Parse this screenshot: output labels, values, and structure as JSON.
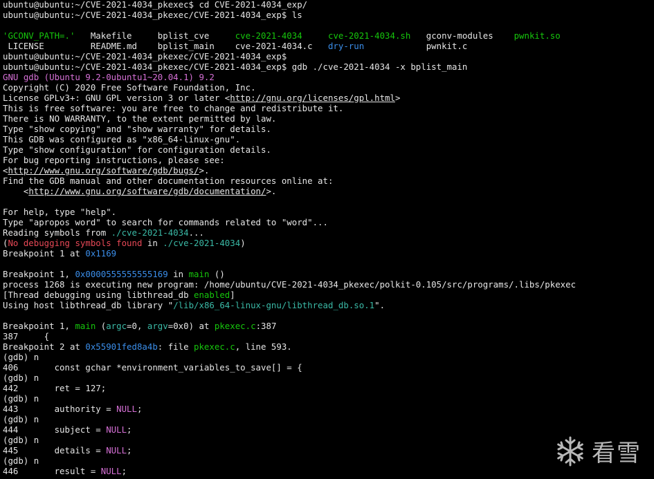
{
  "colors": {
    "background": "#000000",
    "text": "#e6e6e6",
    "lime": "#16c60c",
    "teal": "#3ab9a6",
    "blue": "#3b8eea",
    "red": "#e74856",
    "magenta": "#d670d6"
  },
  "terminal": {
    "lines": [
      [
        {
          "t": "ubuntu@ubuntu:~/CVE-2021-4034_pkexec$ cd CVE-2021-4034_exp/",
          "c": "default"
        }
      ],
      [
        {
          "t": "ubuntu@ubuntu:~/CVE-2021-4034_pkexec/CVE-2021-4034_exp$ ls",
          "c": "default"
        }
      ],
      [
        {
          "t": "",
          "c": "default"
        }
      ],
      [
        {
          "t": "'GCONV_PATH=.'",
          "c": "lime"
        },
        {
          "t": "   Makefile     bplist_cve     ",
          "c": "default"
        },
        {
          "t": "cve-2021-4034",
          "c": "lime"
        },
        {
          "t": "     ",
          "c": "default"
        },
        {
          "t": "cve-2021-4034.sh",
          "c": "lime"
        },
        {
          "t": "   gconv-modules    ",
          "c": "default"
        },
        {
          "t": "pwnkit.so",
          "c": "lime"
        }
      ],
      [
        {
          "t": " LICENSE         README.md    bplist_main    cve-2021-4034.c   ",
          "c": "default"
        },
        {
          "t": "dry-run",
          "c": "blue"
        },
        {
          "t": "            pwnkit.c",
          "c": "default"
        }
      ],
      [
        {
          "t": "ubuntu@ubuntu:~/CVE-2021-4034_pkexec/CVE-2021-4034_exp$",
          "c": "default"
        }
      ],
      [
        {
          "t": "ubuntu@ubuntu:~/CVE-2021-4034_pkexec/CVE-2021-4034_exp$ gdb ./cve-2021-4034 -x bplist_main",
          "c": "default"
        }
      ],
      [
        {
          "t": "GNU gdb (Ubuntu 9.2-0ubuntu1~20.04.1) 9.2",
          "c": "magenta"
        }
      ],
      [
        {
          "t": "Copyright (C) 2020 Free Software Foundation, Inc.",
          "c": "default"
        }
      ],
      [
        {
          "t": "License GPLv3+: GNU GPL version 3 or later <",
          "c": "default"
        },
        {
          "t": "http://gnu.org/licenses/gpl.html",
          "c": "link"
        },
        {
          "t": ">",
          "c": "default"
        }
      ],
      [
        {
          "t": "This is free software: you are free to change and redistribute it.",
          "c": "default"
        }
      ],
      [
        {
          "t": "There is NO WARRANTY, to the extent permitted by law.",
          "c": "default"
        }
      ],
      [
        {
          "t": "Type \"show copying\" and \"show warranty\" for details.",
          "c": "default"
        }
      ],
      [
        {
          "t": "This GDB was configured as \"x86_64-linux-gnu\".",
          "c": "default"
        }
      ],
      [
        {
          "t": "Type \"show configuration\" for configuration details.",
          "c": "default"
        }
      ],
      [
        {
          "t": "For bug reporting instructions, please see:",
          "c": "default"
        }
      ],
      [
        {
          "t": "<",
          "c": "default"
        },
        {
          "t": "http://www.gnu.org/software/gdb/bugs/",
          "c": "link"
        },
        {
          "t": ">.",
          "c": "default"
        }
      ],
      [
        {
          "t": "Find the GDB manual and other documentation resources online at:",
          "c": "default"
        }
      ],
      [
        {
          "t": "    <",
          "c": "default"
        },
        {
          "t": "http://www.gnu.org/software/gdb/documentation/",
          "c": "link"
        },
        {
          "t": ">.",
          "c": "default"
        }
      ],
      [
        {
          "t": "",
          "c": "default"
        }
      ],
      [
        {
          "t": "For help, type \"help\".",
          "c": "default"
        }
      ],
      [
        {
          "t": "Type \"apropos word\" to search for commands related to \"word\"...",
          "c": "default"
        }
      ],
      [
        {
          "t": "Reading symbols from ",
          "c": "default"
        },
        {
          "t": "./cve-2021-4034",
          "c": "teal"
        },
        {
          "t": "...",
          "c": "default"
        }
      ],
      [
        {
          "t": "(",
          "c": "default"
        },
        {
          "t": "No debugging symbols found",
          "c": "red"
        },
        {
          "t": " in ",
          "c": "default"
        },
        {
          "t": "./cve-2021-4034",
          "c": "teal"
        },
        {
          "t": ")",
          "c": "default"
        }
      ],
      [
        {
          "t": "Breakpoint 1 at ",
          "c": "default"
        },
        {
          "t": "0x1169",
          "c": "blue"
        }
      ],
      [
        {
          "t": "",
          "c": "default"
        }
      ],
      [
        {
          "t": "Breakpoint 1, ",
          "c": "default"
        },
        {
          "t": "0x0000555555555169",
          "c": "blue"
        },
        {
          "t": " in ",
          "c": "default"
        },
        {
          "t": "main",
          "c": "lime"
        },
        {
          "t": " ()",
          "c": "default"
        }
      ],
      [
        {
          "t": "process 1268 is executing new program: /home/ubuntu/CVE-2021-4034_pkexec/polkit-0.105/src/programs/.libs/pkexec",
          "c": "default"
        }
      ],
      [
        {
          "t": "[Thread debugging using libthread_db ",
          "c": "default"
        },
        {
          "t": "enabled",
          "c": "lime"
        },
        {
          "t": "]",
          "c": "default"
        }
      ],
      [
        {
          "t": "Using host libthread_db library \"",
          "c": "default"
        },
        {
          "t": "/lib/x86_64-linux-gnu/libthread_db.so.1",
          "c": "teal"
        },
        {
          "t": "\".",
          "c": "default"
        }
      ],
      [
        {
          "t": "",
          "c": "default"
        }
      ],
      [
        {
          "t": "Breakpoint 1, ",
          "c": "default"
        },
        {
          "t": "main",
          "c": "lime"
        },
        {
          "t": " (",
          "c": "default"
        },
        {
          "t": "argc",
          "c": "teal"
        },
        {
          "t": "=0, ",
          "c": "default"
        },
        {
          "t": "argv",
          "c": "teal"
        },
        {
          "t": "=0x0) at ",
          "c": "default"
        },
        {
          "t": "pkexec.c",
          "c": "lime"
        },
        {
          "t": ":387",
          "c": "default"
        }
      ],
      [
        {
          "t": "387     {",
          "c": "default"
        }
      ],
      [
        {
          "t": "Breakpoint 2 at ",
          "c": "default"
        },
        {
          "t": "0x55901fed8a4b",
          "c": "blue"
        },
        {
          "t": ": file ",
          "c": "default"
        },
        {
          "t": "pkexec.c",
          "c": "lime"
        },
        {
          "t": ", line 593.",
          "c": "default"
        }
      ],
      [
        {
          "t": "(gdb) n",
          "c": "default"
        }
      ],
      [
        {
          "t": "406       const gchar *environment_variables_to_save[] = {",
          "c": "default"
        }
      ],
      [
        {
          "t": "(gdb) n",
          "c": "default"
        }
      ],
      [
        {
          "t": "442       ret = 127;",
          "c": "default"
        }
      ],
      [
        {
          "t": "(gdb) n",
          "c": "default"
        }
      ],
      [
        {
          "t": "443       authority = ",
          "c": "default"
        },
        {
          "t": "NULL",
          "c": "magenta"
        },
        {
          "t": ";",
          "c": "default"
        }
      ],
      [
        {
          "t": "(gdb) n",
          "c": "default"
        }
      ],
      [
        {
          "t": "444       subject = ",
          "c": "default"
        },
        {
          "t": "NULL",
          "c": "magenta"
        },
        {
          "t": ";",
          "c": "default"
        }
      ],
      [
        {
          "t": "(gdb) n",
          "c": "default"
        }
      ],
      [
        {
          "t": "445       details = ",
          "c": "default"
        },
        {
          "t": "NULL",
          "c": "magenta"
        },
        {
          "t": ";",
          "c": "default"
        }
      ],
      [
        {
          "t": "(gdb) n",
          "c": "default"
        }
      ],
      [
        {
          "t": "446       result = ",
          "c": "default"
        },
        {
          "t": "NULL",
          "c": "magenta"
        },
        {
          "t": ";",
          "c": "default"
        }
      ]
    ]
  },
  "watermark": {
    "icon": "snowflake-icon",
    "text": "看雪"
  }
}
